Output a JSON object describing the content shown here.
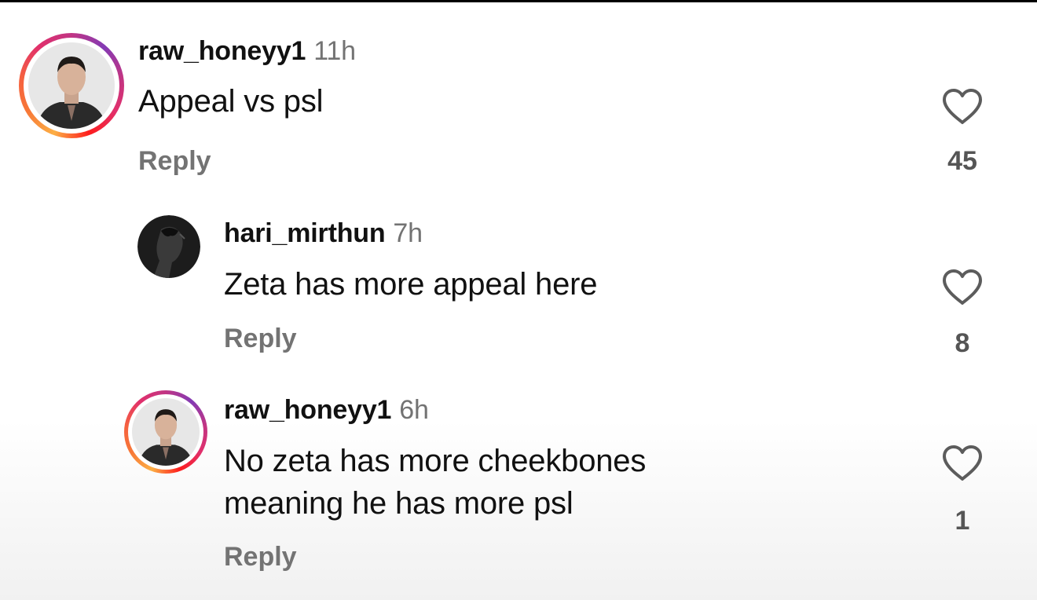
{
  "comments": [
    {
      "username": "raw_honeyy1",
      "time": "11h",
      "text": "Appeal vs psl",
      "reply_label": "Reply",
      "likes": "45",
      "has_story_ring": true
    },
    {
      "username": "hari_mirthun",
      "time": "7h",
      "text": "Zeta has more appeal here",
      "reply_label": "Reply",
      "likes": "8",
      "has_story_ring": false
    },
    {
      "username": "raw_honeyy1",
      "time": "6h",
      "text": "No zeta has more cheekbones meaning he has more psl",
      "reply_label": "Reply",
      "likes": "1",
      "has_story_ring": true
    }
  ],
  "icons": {
    "like": "heart-outline-icon"
  },
  "colors": {
    "text_primary": "#111111",
    "text_secondary": "#737373",
    "story_ring_start": "#fcaf45",
    "story_ring_end": "#833ab4"
  }
}
